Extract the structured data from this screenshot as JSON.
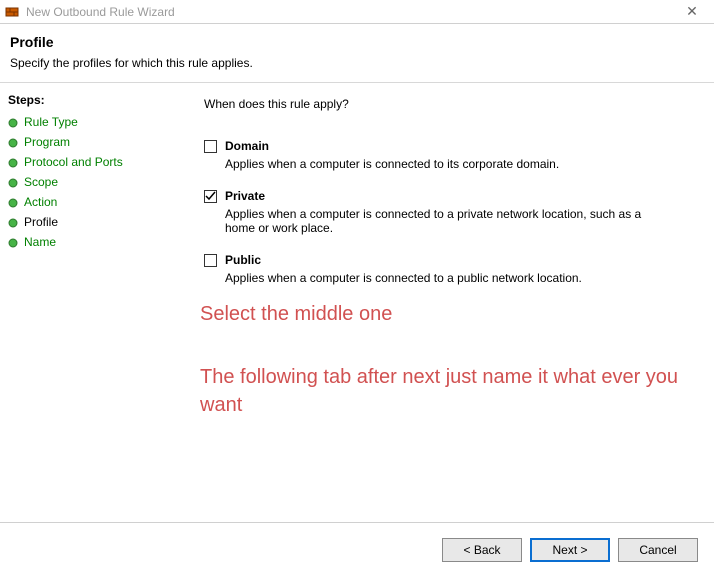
{
  "window": {
    "title": "New Outbound Rule Wizard",
    "close": "✕"
  },
  "header": {
    "title": "Profile",
    "subtitle": "Specify the profiles for which this rule applies."
  },
  "steps": {
    "title": "Steps:",
    "items": [
      {
        "label": "Rule Type",
        "current": false
      },
      {
        "label": "Program",
        "current": false
      },
      {
        "label": "Protocol and Ports",
        "current": false
      },
      {
        "label": "Scope",
        "current": false
      },
      {
        "label": "Action",
        "current": false
      },
      {
        "label": "Profile",
        "current": true
      },
      {
        "label": "Name",
        "current": false
      }
    ]
  },
  "content": {
    "prompt": "When does this rule apply?",
    "options": [
      {
        "label": "Domain",
        "checked": false,
        "description": "Applies when a computer is connected to its corporate domain."
      },
      {
        "label": "Private",
        "checked": true,
        "description": "Applies when a computer is connected to a private network location, such as a home or work place."
      },
      {
        "label": "Public",
        "checked": false,
        "description": "Applies when a computer is connected to a public network location."
      }
    ]
  },
  "annotations": {
    "line1": "Select the middle one",
    "line2": "The following tab after next just name it what ever you want"
  },
  "footer": {
    "back": "< Back",
    "next": "Next >",
    "cancel": "Cancel"
  }
}
